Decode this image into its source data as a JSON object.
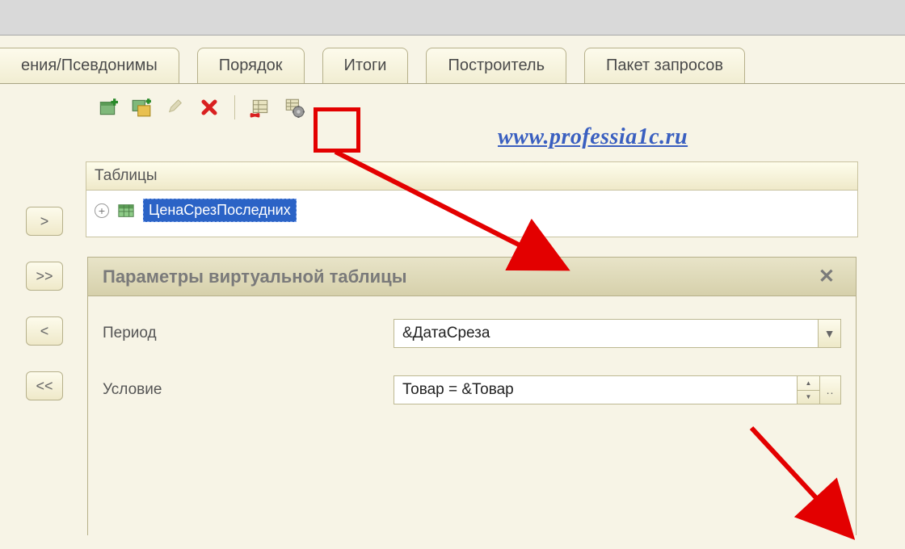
{
  "tabs": [
    "ения/Псевдонимы",
    "Порядок",
    "Итоги",
    "Построитель",
    "Пакет запросов"
  ],
  "link": "www.professia1c.ru",
  "tables": {
    "header": "Таблицы",
    "item": "ЦенаСрезПоследних"
  },
  "nav": {
    "r": ">",
    "rr": ">>",
    "l": "<",
    "ll": "<<"
  },
  "dialog": {
    "title": "Параметры виртуальной таблицы",
    "rows": {
      "period": {
        "label": "Период",
        "value": "&ДатаСреза"
      },
      "condition": {
        "label": "Условие",
        "value": "Товар = &Товар"
      }
    }
  }
}
